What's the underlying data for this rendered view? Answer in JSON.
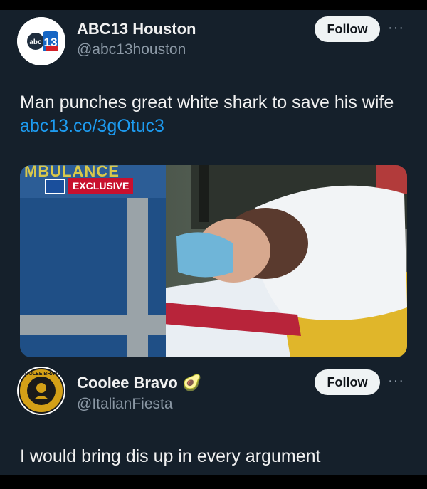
{
  "posts": [
    {
      "name": "ABC13 Houston",
      "handle": "@abc13houston",
      "follow_label": "Follow",
      "more_label": "···",
      "avatar_text": "abc13",
      "text": "Man punches great white shark to save his wife ",
      "link": "abc13.co/3gOtuc3",
      "media": {
        "badge_label": "EXCLUSIVE",
        "overlay_text": "MBULANCE"
      }
    },
    {
      "name": "Coolee Bravo",
      "name_emoji": "🥑",
      "handle": "@ItalianFiesta",
      "follow_label": "Follow",
      "more_label": "···",
      "avatar_ring_text": "COOLEE BRAVO",
      "text": "I would bring dis up in every argument"
    }
  ],
  "colors": {
    "background": "#15202b",
    "link": "#1d9bf0",
    "follow_button": "#eff3f4",
    "badge_red": "#c8102e"
  }
}
